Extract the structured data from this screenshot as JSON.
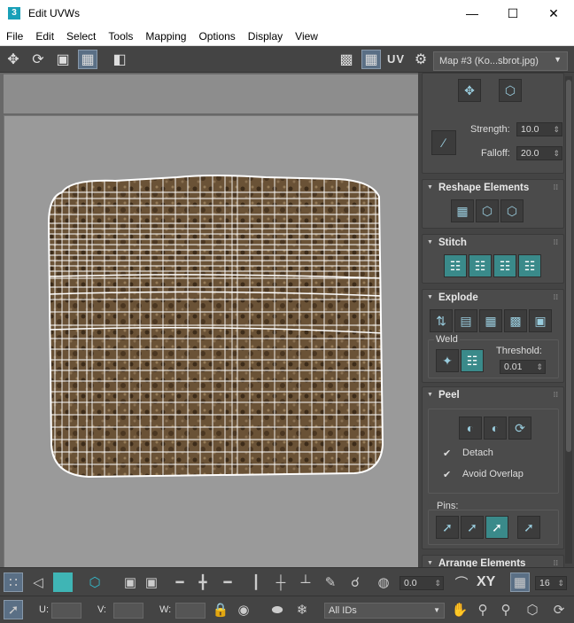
{
  "window": {
    "title": "Edit UVWs",
    "app_icon": "3"
  },
  "menu": [
    "File",
    "Edit",
    "Select",
    "Tools",
    "Mapping",
    "Options",
    "Display",
    "View"
  ],
  "toolbar": {
    "uv_label": "UV",
    "map_dropdown": "Map #3 (Ko...sbrot.jpg)"
  },
  "panel": {
    "strength_label": "Strength:",
    "strength_value": "10.0",
    "falloff_label": "Falloff:",
    "falloff_value": "20.0",
    "reshape_title": "Reshape Elements",
    "stitch_title": "Stitch",
    "explode_title": "Explode",
    "weld_label": "Weld",
    "threshold_label": "Threshold:",
    "threshold_value": "0.01",
    "peel_title": "Peel",
    "detach_label": "Detach",
    "avoid_overlap_label": "Avoid Overlap",
    "pins_label": "Pins:",
    "arrange_title": "Arrange Elements"
  },
  "bottom": {
    "angle_value": "0.0",
    "xy_label": "XY",
    "grid_value": "16",
    "u_label": "U:",
    "v_label": "V:",
    "w_label": "W:",
    "ids_dropdown": "All IDs"
  }
}
